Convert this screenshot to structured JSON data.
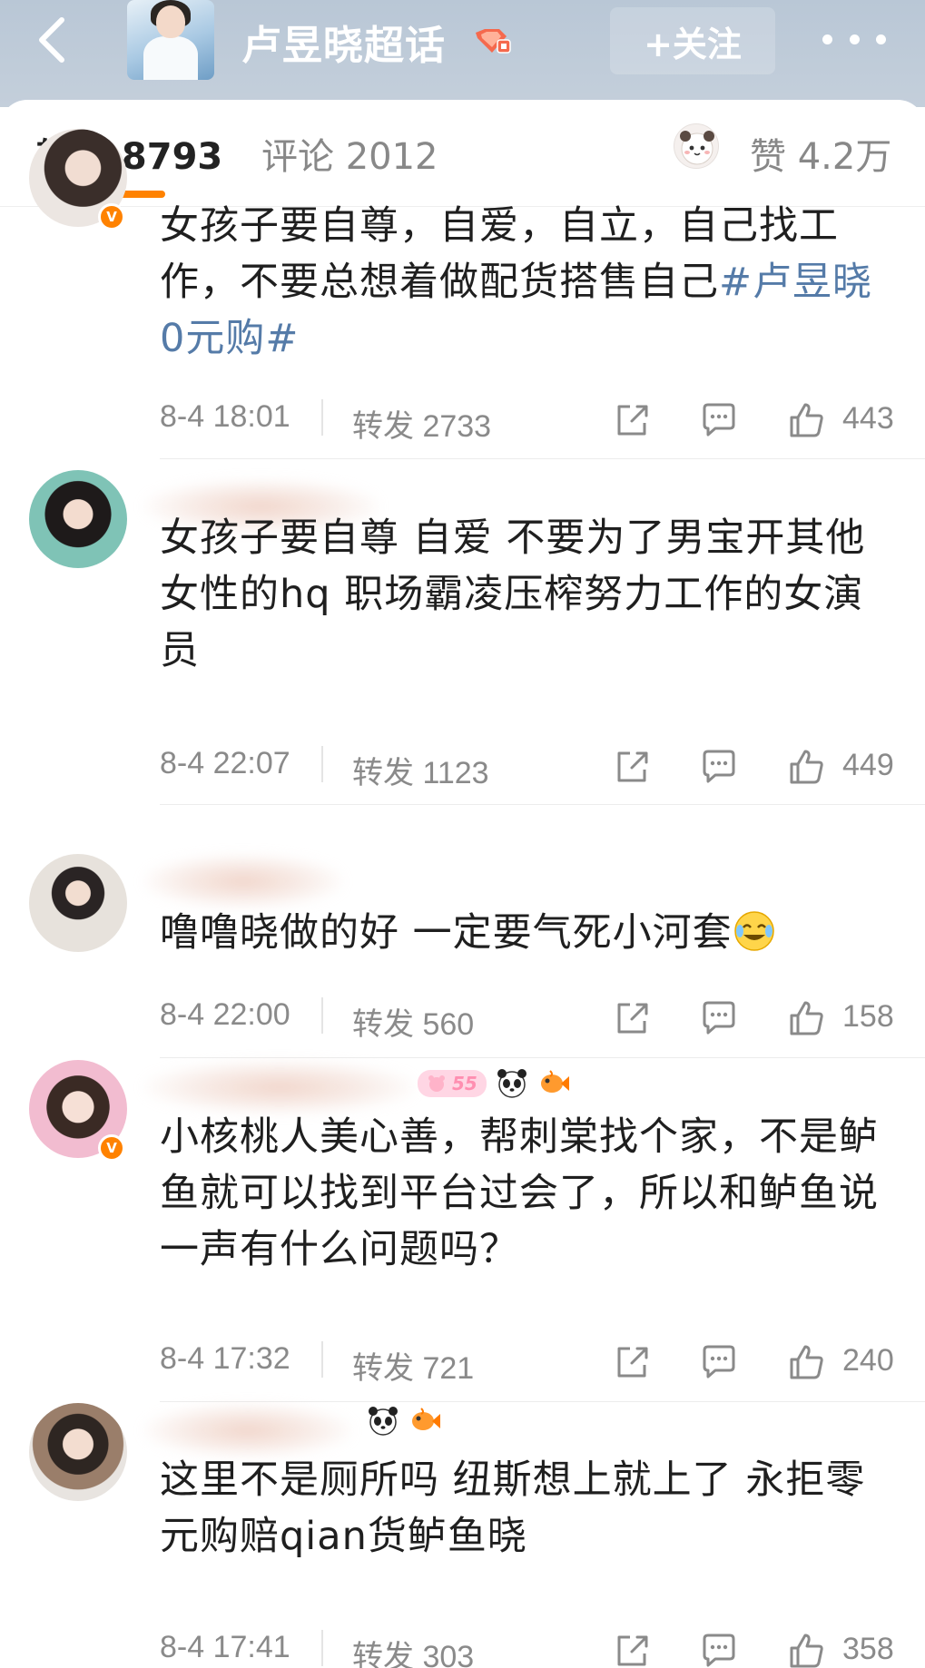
{
  "header": {
    "title": "卢昱晓超话",
    "follow_label": "+关注"
  },
  "tabs": {
    "repost": "转发 8793",
    "comments": "评论 2012",
    "likes": "赞 4.2万"
  },
  "comments": [
    {
      "text_main": "女孩子要自尊，自爱，自立，自己找工作，不要总想着做配货搭售自己",
      "text_hashtag": "#卢昱晓0元购#",
      "time": "8-4 18:01",
      "reposts": "转发 2733",
      "likes": "443"
    },
    {
      "text_main": "女孩子要自尊 自爱 不要为了男宝开其他女性的hq 职场霸凌压榨努力工作的女演员",
      "time": "8-4 22:07",
      "reposts": "转发 1123",
      "likes": "449"
    },
    {
      "text_main": "噜噜晓做的好 一定要气死小河套",
      "time": "8-4 22:00",
      "reposts": "转发 560",
      "likes": "158"
    },
    {
      "text_main": "小核桃人美心善，帮刺棠找个家，不是鲈鱼就可以找到平台过会了，所以和鲈鱼说一声有什么问题吗？",
      "time": "8-4 17:32",
      "reposts": "转发 721",
      "likes": "240",
      "fan_badge": "55"
    },
    {
      "text_main": "这里不是厕所吗 纽斯想上就上了 永拒零元购赔qian货鲈鱼晓",
      "time": "8-4 17:41",
      "reposts": "转发 303",
      "likes": "358"
    }
  ],
  "icons": {
    "back": "chevron-left-icon",
    "more": "more-dots-icon",
    "share": "share-icon",
    "comment": "comment-icon",
    "like": "thumbs-up-icon",
    "panda": "panda-icon",
    "fish": "fish-icon"
  },
  "colors": {
    "accent": "#ff8200",
    "hashtag": "#557ba8",
    "header_bg": "#bdc9d7"
  }
}
